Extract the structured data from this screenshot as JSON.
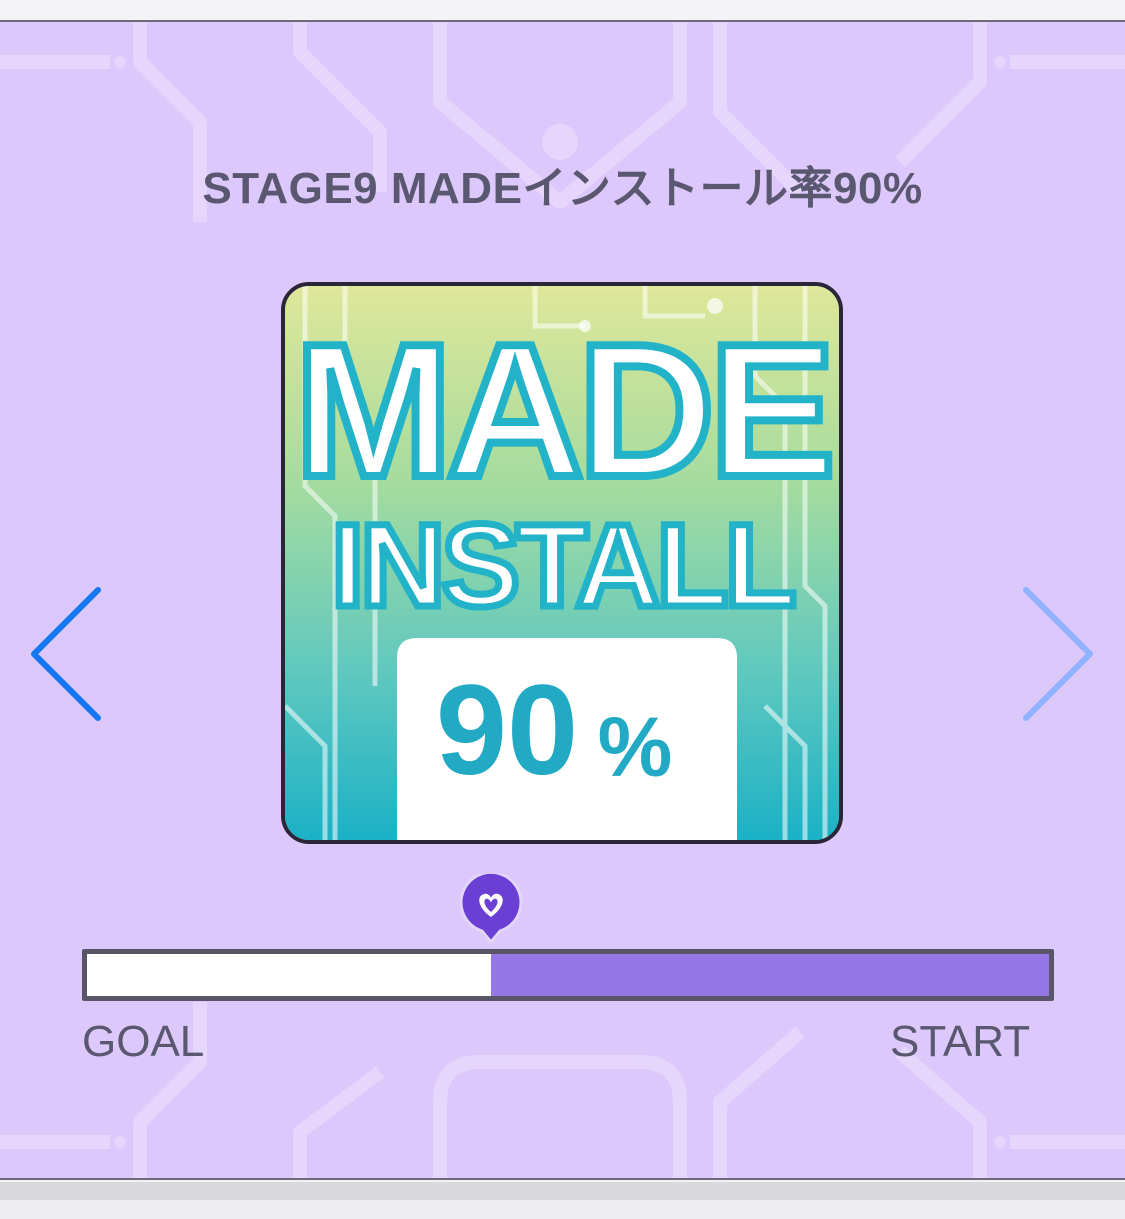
{
  "stage": {
    "title": "STAGE9 MADEインストール率90%"
  },
  "card": {
    "logo_text": "MADE",
    "install_text": "INSTALL",
    "percent_value": "90",
    "percent_sign": "%"
  },
  "progress": {
    "goal_label": "GOAL",
    "start_label": "START",
    "remaining_fraction": 0.42
  },
  "nav": {
    "prev_icon": "chevron-left-icon",
    "next_icon": "chevron-right-icon"
  },
  "colors": {
    "panel_bg": "#ddc8fb",
    "accent_purple": "#9677e6",
    "marker_purple": "#6b3fd3",
    "arrow_left": "#1677f5",
    "arrow_right": "#8fb3ff",
    "text": "#5a5770",
    "card_teal": "#22b3c9"
  }
}
